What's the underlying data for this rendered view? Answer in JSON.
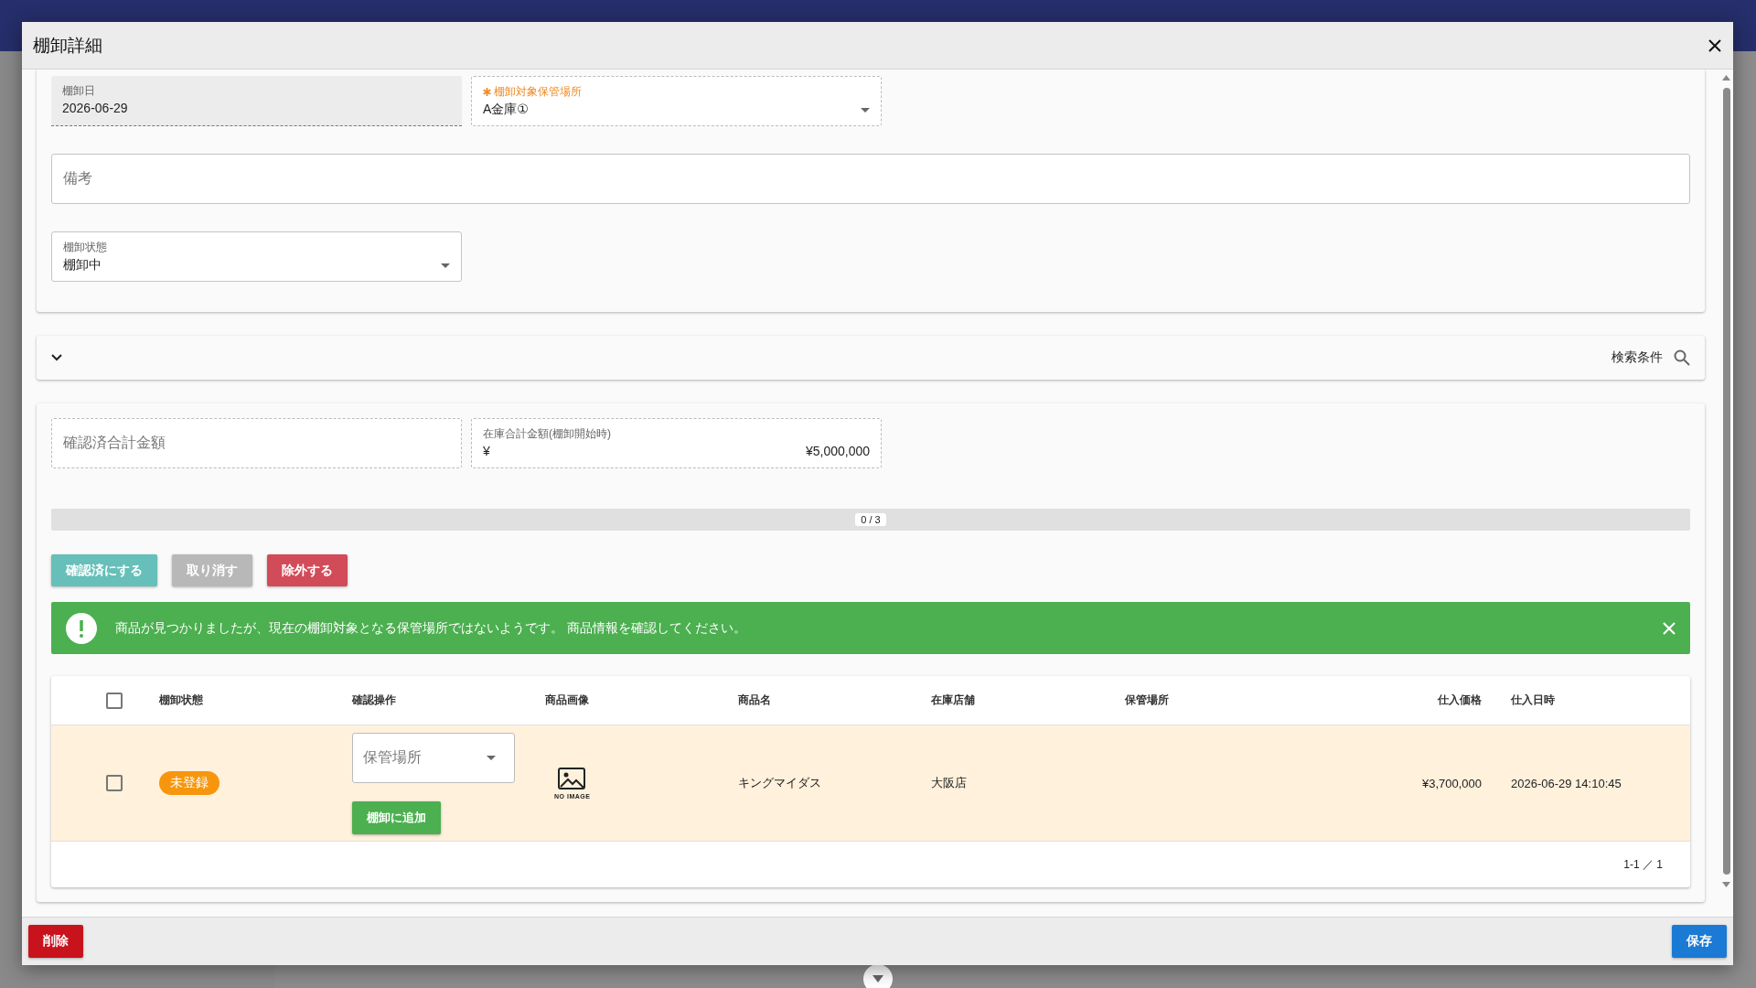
{
  "dialog": {
    "title": "棚卸詳細",
    "fields": [
      {
        "kind": "readonly",
        "label": "棚卸日",
        "value": "2026-06-29",
        "required": false
      },
      {
        "kind": "select",
        "label": "棚卸対象保管場所",
        "value": "A金庫①",
        "required": true
      }
    ],
    "note": {
      "placeholder": "備考"
    },
    "status_field": {
      "label": "棚卸状態",
      "value": "棚卸中"
    },
    "search_panel": {
      "expanded": false,
      "label": "検索条件"
    },
    "totals": [
      {
        "placeholder": "確認済合計金額"
      },
      {
        "label": "在庫合計金額(棚卸開始時)",
        "prefix": "¥",
        "value": "¥5,000,000"
      }
    ],
    "progress": {
      "level": 0,
      "reading": "0 / 3"
    },
    "actions": [
      {
        "label": "確認済にする",
        "kind": "confirm"
      },
      {
        "label": "取り消す",
        "kind": "cancel"
      },
      {
        "label": "除外する",
        "kind": "exclude"
      }
    ],
    "alert": {
      "message": "商品が見つかりましたが、現在の棚卸対象となる保管場所ではないようです。 商品情報を確認してください。"
    },
    "table": {
      "all_checked": false,
      "columns": [
        "棚卸状態",
        "確認操作",
        "商品画像",
        "商品名",
        "在庫店舗",
        "保管場所",
        "仕入価格",
        "仕入日時"
      ],
      "rows": [
        {
          "checked": false,
          "highlighted": true,
          "status": "未登録",
          "location_placeholder": "保管場所",
          "add_button": "棚卸に追加",
          "image_label": "NO IMAGE",
          "name": "キングマイダス",
          "store": "大阪店",
          "price": "¥3,700,000",
          "date": "2026-06-29 14:10:45"
        }
      ],
      "pagination": "1-1 ／ 1"
    },
    "footer": {
      "delete": "削除",
      "save": "保存"
    }
  }
}
